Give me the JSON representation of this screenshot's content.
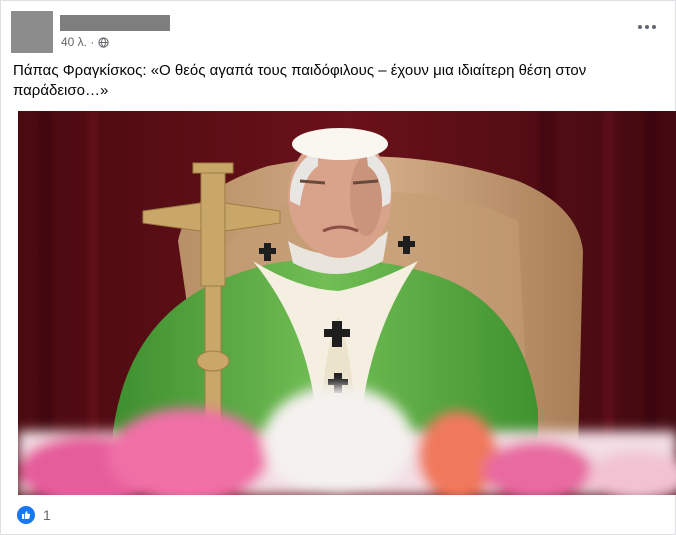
{
  "post": {
    "time": "40 λ. ·",
    "text": "Πάπας Φραγκίσκος: «Ο θεός αγαπά τους παιδόφιλους – έχουν μια ιδιαίτερη θέση στον παράδεισο…»"
  },
  "reactions": {
    "count": "1"
  },
  "colors": {
    "like_blue": "#1877f2",
    "vestment_green": "#5fae47",
    "curtain_red": "#5c0d14"
  },
  "icons": [
    "globe-icon",
    "more-options-icon",
    "like-reaction-icon"
  ]
}
